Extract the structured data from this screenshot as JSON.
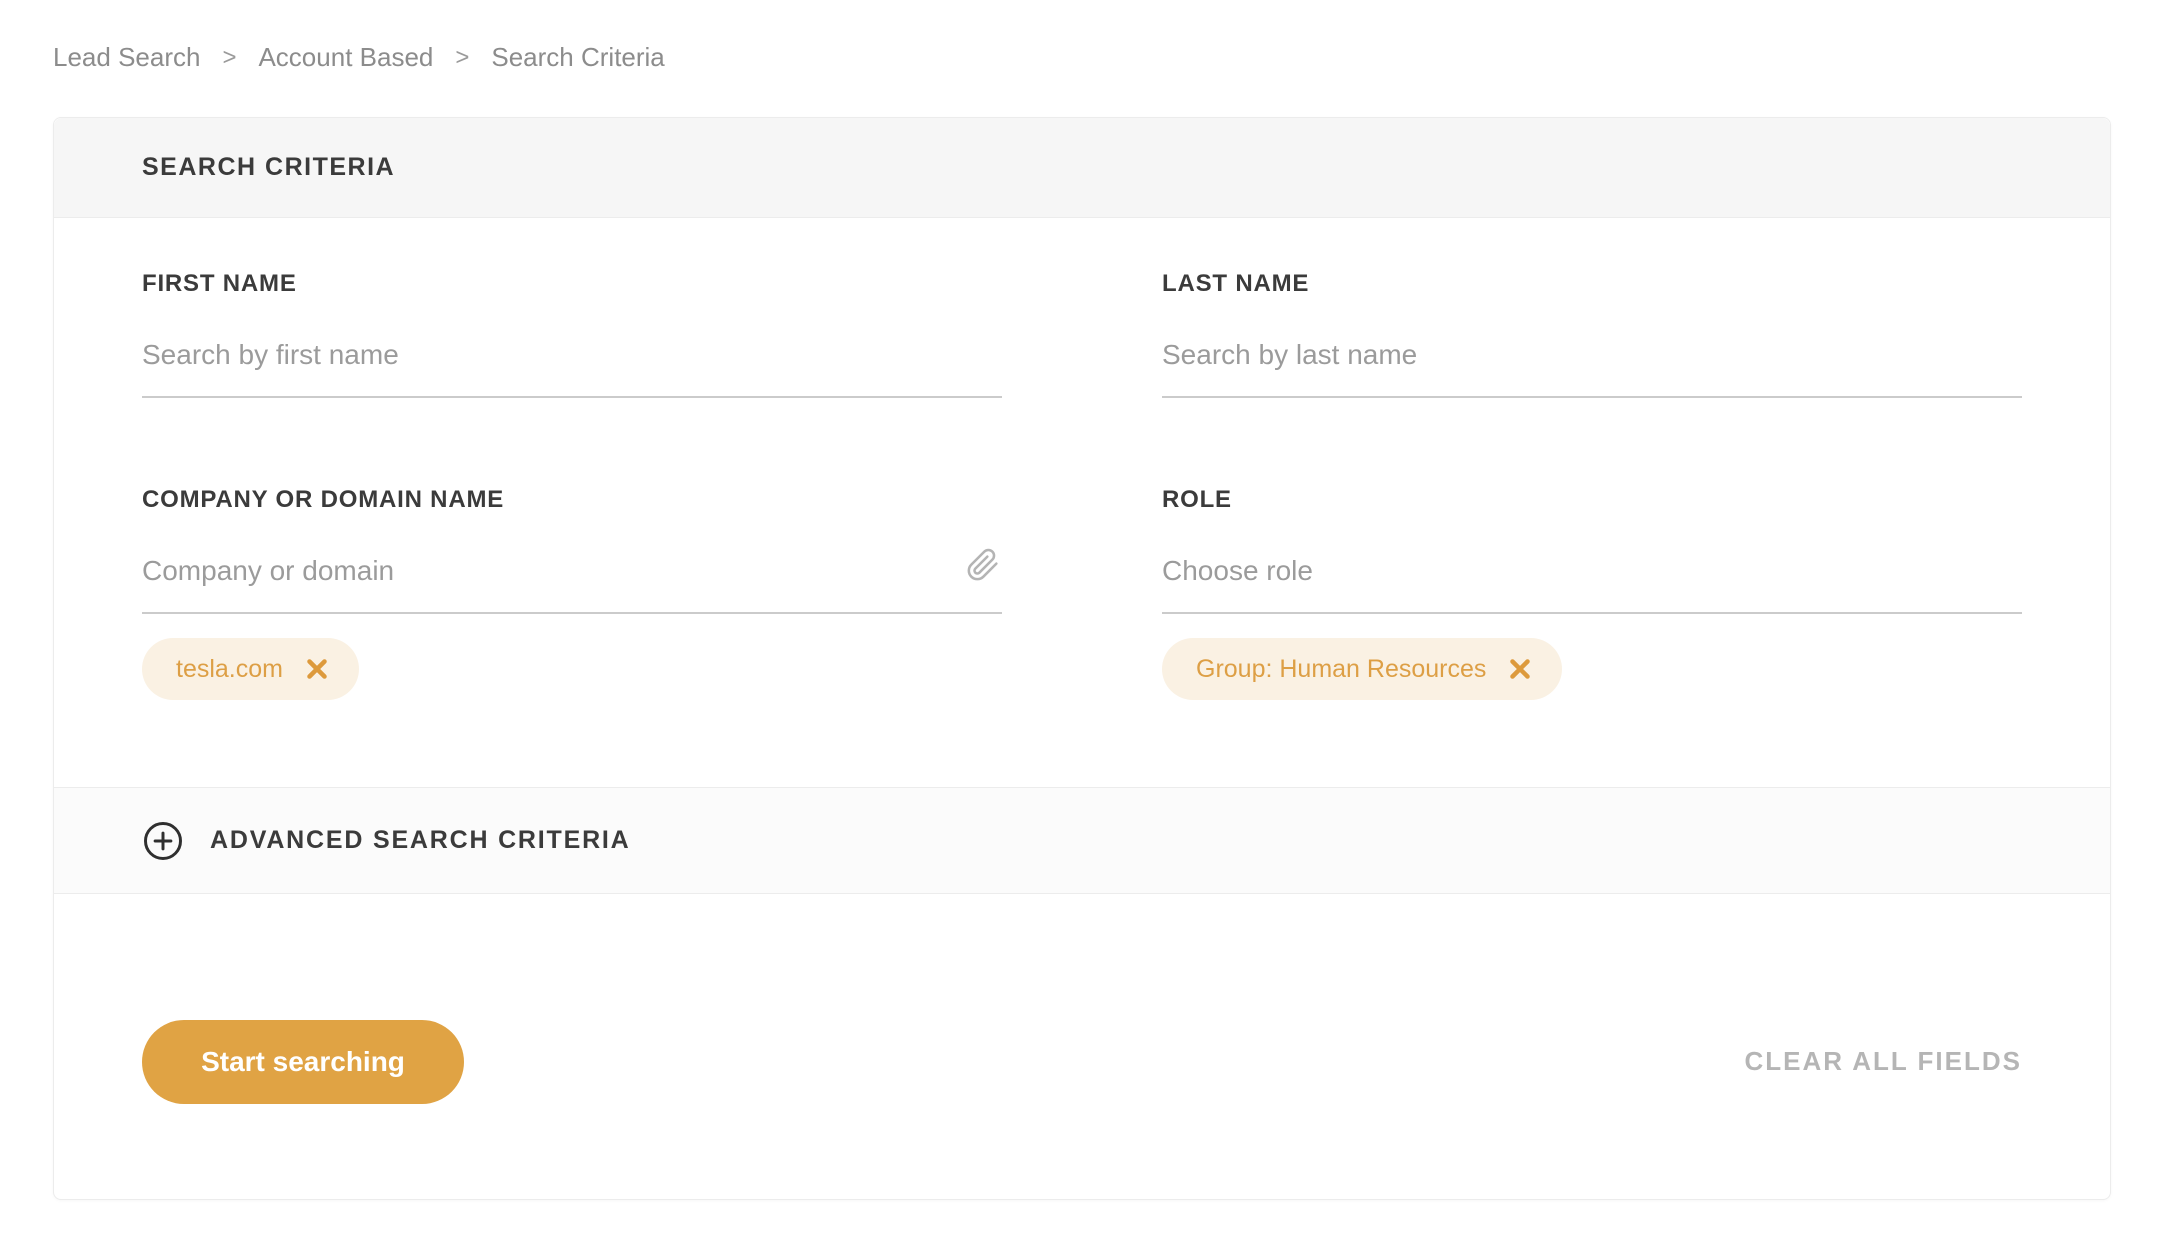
{
  "breadcrumb": {
    "separator": ">",
    "items": [
      {
        "label": "Lead Search"
      },
      {
        "label": "Account Based"
      },
      {
        "label": "Search Criteria"
      }
    ]
  },
  "card": {
    "header": {
      "title": "SEARCH CRITERIA"
    },
    "fields": {
      "first_name": {
        "label": "FIRST NAME",
        "placeholder": "Search by first name",
        "value": ""
      },
      "last_name": {
        "label": "LAST NAME",
        "placeholder": "Search by last name",
        "value": ""
      },
      "company": {
        "label": "COMPANY OR DOMAIN NAME",
        "placeholder": "Company or domain",
        "value": "",
        "icon": "paperclip-icon",
        "tags": [
          {
            "label": "tesla.com"
          }
        ]
      },
      "role": {
        "label": "ROLE",
        "placeholder": "Choose role",
        "value": "",
        "tags": [
          {
            "label": "Group: Human Resources"
          }
        ]
      }
    },
    "advanced": {
      "icon": "plus-circle-icon",
      "label": "ADVANCED SEARCH CRITERIA"
    },
    "footer": {
      "start_label": "Start searching",
      "clear_label": "CLEAR ALL FIELDS"
    }
  },
  "colors": {
    "accent_orange": "#e0a344",
    "tag_background": "#faf1e3",
    "tag_text": "#dd9f45",
    "header_background": "#f6f6f6",
    "advanced_background": "#fbfbfb",
    "border": "#ececec",
    "label_text": "#3b3b3b",
    "placeholder_text": "#9b9b9b",
    "breadcrumb_text": "#8c8c8c",
    "clear_text": "#b5b5b5"
  }
}
